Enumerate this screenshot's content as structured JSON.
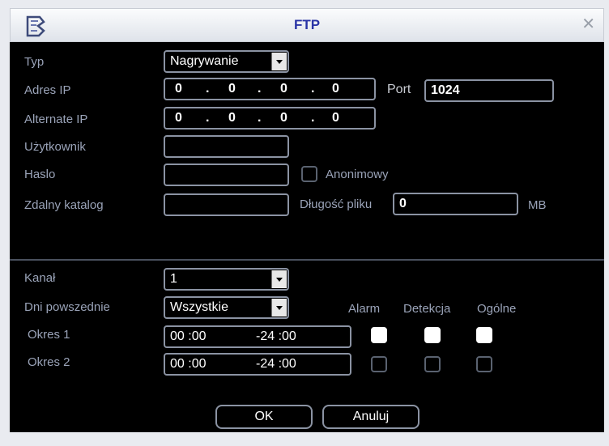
{
  "window": {
    "title": "FTP",
    "logo_icon": "logo-icon",
    "close_icon": "close-icon"
  },
  "form": {
    "typ_label": "Typ",
    "typ_value": "Nagrywanie",
    "ip_label": "Adres IP",
    "ip_octets": [
      "0",
      "0",
      "0",
      "0"
    ],
    "port_label": "Port",
    "port_value": "1024",
    "alt_ip_label": "Alternate IP",
    "alt_ip_octets": [
      "0",
      "0",
      "0",
      "0"
    ],
    "user_label": "Użytkownik",
    "user_value": "",
    "password_label": "Haslo",
    "password_value": "",
    "anon_label": "Anonimowy",
    "remote_dir_label": "Zdalny katalog",
    "remote_dir_value": "",
    "file_len_label": "Długość pliku",
    "file_len_value": "0",
    "file_len_unit": "MB"
  },
  "schedule": {
    "channel_label": "Kanał",
    "channel_value": "1",
    "days_label": "Dni powszednie",
    "days_value": "Wszystkie",
    "col_alarm": "Alarm",
    "col_detection": "Detekcja",
    "col_general": "Ogólne",
    "periods": [
      {
        "label": "Okres 1",
        "start": "00 :00",
        "end": "-24 :00",
        "alarm": true,
        "detection": true,
        "general": true
      },
      {
        "label": "Okres 2",
        "start": "00 :00",
        "end": "-24 :00",
        "alarm": false,
        "detection": false,
        "general": false
      }
    ]
  },
  "buttons": {
    "ok": "OK",
    "cancel": "Anuluj"
  }
}
